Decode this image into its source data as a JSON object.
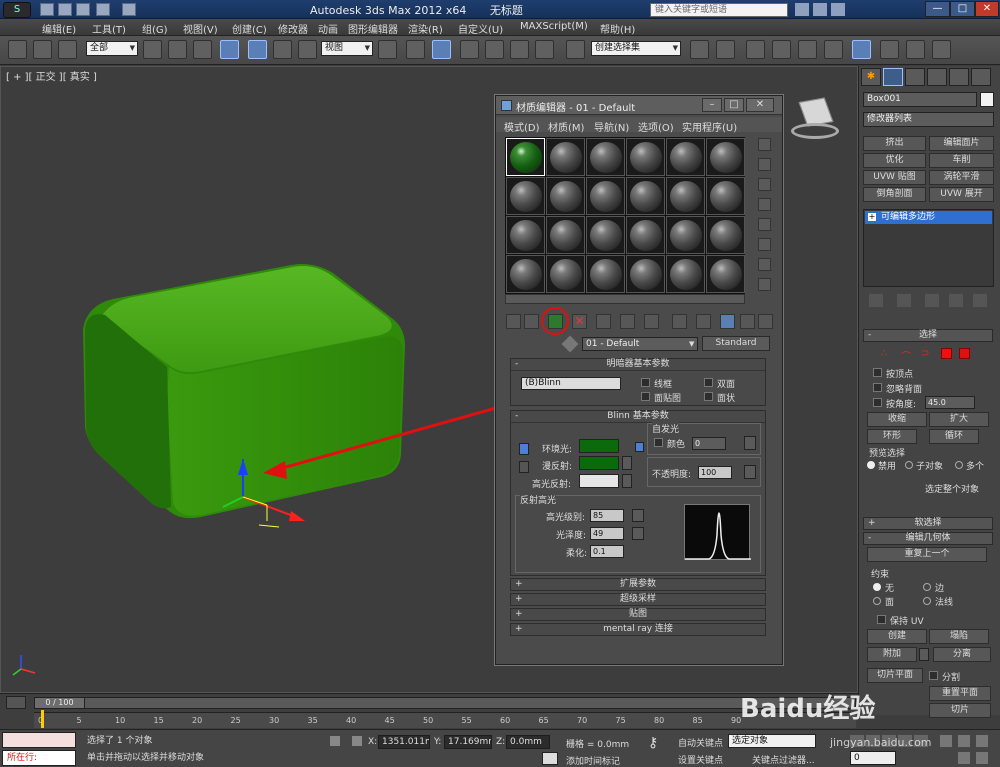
{
  "titlebar": {
    "app_title": "Autodesk 3ds Max 2012 x64",
    "file_name": "无标题",
    "search_placeholder": "键入关键字或短语",
    "minimize": "—",
    "maximize": "□",
    "close": "✕"
  },
  "menubar": {
    "items": [
      "编辑(E)",
      "工具(T)",
      "组(G)",
      "视图(V)",
      "创建(C)",
      "修改器",
      "动画",
      "图形编辑器",
      "渲染(R)",
      "自定义(U)",
      "MAXScript(M)",
      "帮助(H)"
    ]
  },
  "toolbar": {
    "selection_filter": "全部",
    "ref_coord": "视图",
    "named_selection": "创建选择集"
  },
  "viewport": {
    "label": "[ + ][ 正交 ][ 真实 ]",
    "object_color": "#3a9a10"
  },
  "material_editor": {
    "title": "材质编辑器 - 01 - Default",
    "menu": [
      "模式(D)",
      "材质(M)",
      "导航(N)",
      "选项(O)",
      "实用程序(U)"
    ],
    "slot_count": 24,
    "active_material": "01 - Default",
    "type_button": "Standard",
    "shader_rollout": "明暗器基本参数",
    "shader_type": "(B)Blinn",
    "shader_opts": [
      "线框",
      "双面",
      "面贴图",
      "面状"
    ],
    "blinn_rollout": "Blinn 基本参数",
    "self_illum_title": "自发光",
    "self_illum_color_label": "颜色",
    "self_illum_value": "0",
    "ambient_label": "环境光:",
    "diffuse_label": "漫反射:",
    "specular_label": "高光反射:",
    "ambient_color": "#0b6a0b",
    "diffuse_color": "#0b6a0b",
    "specular_color": "#e6e6e6",
    "opacity_label": "不透明度:",
    "opacity_value": "100",
    "spec_group": "反射高光",
    "spec_level_label": "高光级别:",
    "spec_level": "85",
    "gloss_label": "光泽度:",
    "gloss": "49",
    "soften_label": "柔化:",
    "soften": "0.1",
    "rollouts": [
      "扩展参数",
      "超级采样",
      "贴图",
      "mental ray 连接"
    ]
  },
  "command_panel": {
    "object_name": "Box001",
    "modifier_list": "修改器列表",
    "buttons": [
      "挤出",
      "编辑面片",
      "优化",
      "车削",
      "UVW 贴图",
      "涡轮平滑",
      "倒角剖面",
      "UVW 展开"
    ],
    "stack_item": "可编辑多边形",
    "selection_rollout": "选择",
    "by_vertex": "按顶点",
    "ignore_backface": "忽略背面",
    "by_angle": "按角度:",
    "angle_value": "45.0",
    "shrink": "收缩",
    "grow": "扩大",
    "ring": "环形",
    "loop": "循环",
    "preview_title": "预览选择",
    "preview_opts": [
      "禁用",
      "子对象",
      "多个"
    ],
    "select_whole": "选定整个对象",
    "soft_selection": "软选择",
    "edit_geometry": "编辑几何体",
    "repeat_last": "重复上一个",
    "constraints_title": "约束",
    "constraints": [
      "无",
      "边",
      "面",
      "法线"
    ],
    "preserve_uv": "保持 UV",
    "create": "创建",
    "collapse": "塌陷",
    "attach": "附加",
    "detach": "分离",
    "slice_plane": "切片平面",
    "split": "分割",
    "reset_plane": "重置平面",
    "slice": "切片"
  },
  "timeline": {
    "frame_display": "0 / 100",
    "ticks": [
      "0",
      "5",
      "10",
      "15",
      "20",
      "25",
      "30",
      "35",
      "40",
      "45",
      "50",
      "55",
      "60",
      "65",
      "70",
      "75",
      "80",
      "85",
      "90"
    ]
  },
  "status": {
    "listener": "所在行:",
    "selected": "选择了 1 个对象",
    "hint": "单击并拖动以选择并移动对象",
    "x_label": "X:",
    "x_value": "1351.011m",
    "y_label": "Y:",
    "y_value": "17.169mm",
    "z_label": "Z:",
    "z_value": "0.0mm",
    "grid": "栅格 = 0.0mm",
    "add_time_tag": "添加时间标记",
    "auto_key": "自动关键点",
    "set_key": "设置关键点",
    "key_mode": "选定对象",
    "key_filters": "关键点过滤器...",
    "current_frame": "0"
  },
  "watermark": {
    "text": "Baidu经验",
    "url": "jingyan.baidu.com"
  }
}
